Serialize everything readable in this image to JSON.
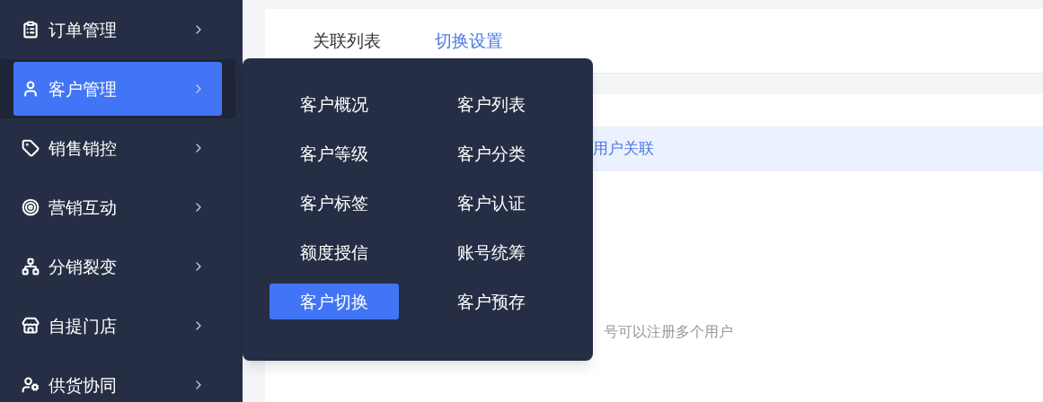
{
  "sidebar": {
    "items": [
      {
        "label": "订单管理",
        "selected": false
      },
      {
        "label": "客户管理",
        "selected": true
      },
      {
        "label": "销售销控",
        "selected": false
      },
      {
        "label": "营销互动",
        "selected": false
      },
      {
        "label": "分销裂变",
        "selected": false
      },
      {
        "label": "自提门店",
        "selected": false
      },
      {
        "label": "供货协同",
        "selected": false
      }
    ]
  },
  "submenu": {
    "items": [
      {
        "label": "客户概况",
        "selected": false
      },
      {
        "label": "客户列表",
        "selected": false
      },
      {
        "label": "客户等级",
        "selected": false
      },
      {
        "label": "客户分类",
        "selected": false
      },
      {
        "label": "客户标签",
        "selected": false
      },
      {
        "label": "客户认证",
        "selected": false
      },
      {
        "label": "额度授信",
        "selected": false
      },
      {
        "label": "账号统筹",
        "selected": false
      },
      {
        "label": "客户切换",
        "selected": true
      },
      {
        "label": "客户预存",
        "selected": false
      }
    ]
  },
  "tabs": [
    {
      "label": "关联列表",
      "selected": false
    },
    {
      "label": "切换设置",
      "selected": true
    }
  ],
  "banner": {
    "text": "用户关联"
  },
  "hint": "号可以注册多个用户"
}
